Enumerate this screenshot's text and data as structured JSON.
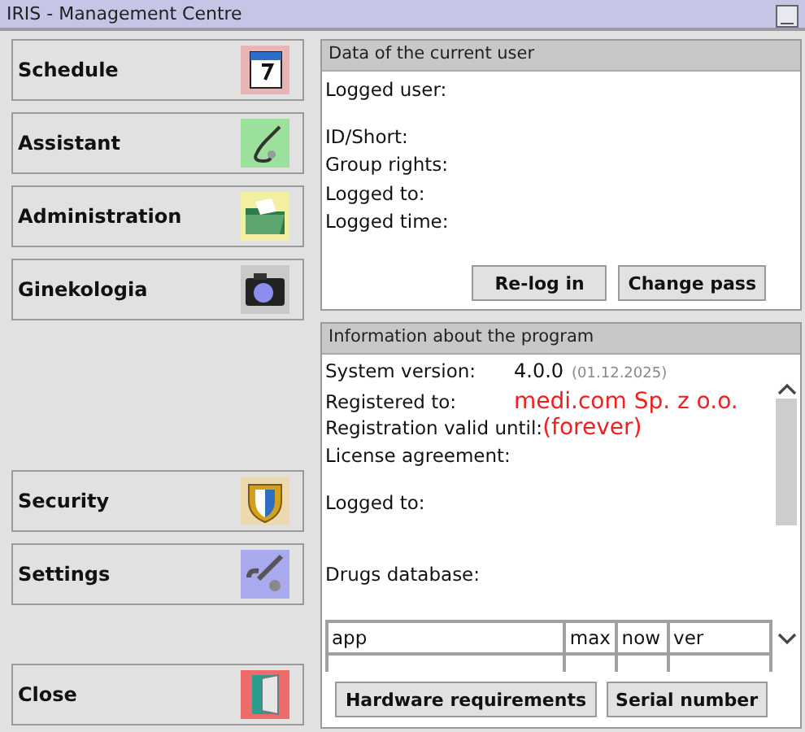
{
  "window": {
    "title": "IRIS - Management Centre"
  },
  "nav": {
    "main_items": [
      {
        "label": "Schedule",
        "kind": "calendar"
      },
      {
        "label": "Assistant",
        "kind": "stethoscope"
      },
      {
        "label": "Administration",
        "kind": "folder"
      },
      {
        "label": "Ginekologia",
        "kind": "camera"
      }
    ],
    "extra_items": [
      {
        "label": "Security",
        "kind": "shield"
      },
      {
        "label": "Settings",
        "kind": "wrench"
      }
    ],
    "close": {
      "label": "Close",
      "kind": "door"
    }
  },
  "user_panel": {
    "title": "Data of the current user",
    "fields": [
      {
        "label": "Logged user:",
        "kind": "field"
      },
      {
        "label": "ID/Short:",
        "kind": "section"
      },
      {
        "label": "Group rights:",
        "kind": "field"
      },
      {
        "label": "Logged to:",
        "kind": "field"
      },
      {
        "label": "Logged time:",
        "kind": "field"
      }
    ],
    "buttons": [
      "Re-log in",
      "Change pass"
    ]
  },
  "program_panel": {
    "title": "Information about the program",
    "fields": [
      {
        "label": "System version:",
        "kind": "field",
        "value": "4.0.0",
        "note": "(01.12.2025)",
        "highlight": false
      },
      {
        "label": "Registered to:",
        "kind": "field",
        "value": "medi.com Sp. z o.o.",
        "highlight": true
      },
      {
        "label": "Registration valid until:",
        "kind": "field",
        "value": "(forever)",
        "highlight": true
      },
      {
        "label": "License agreement:",
        "kind": "field"
      },
      {
        "label": "Logged to:",
        "kind": "section"
      },
      {
        "label": "Drugs database:",
        "kind": "wide_section"
      }
    ],
    "table": {
      "columns": [
        "app",
        "max",
        "now",
        "ver"
      ]
    },
    "buttons": [
      "Hardware requirements",
      "Serial number"
    ]
  }
}
